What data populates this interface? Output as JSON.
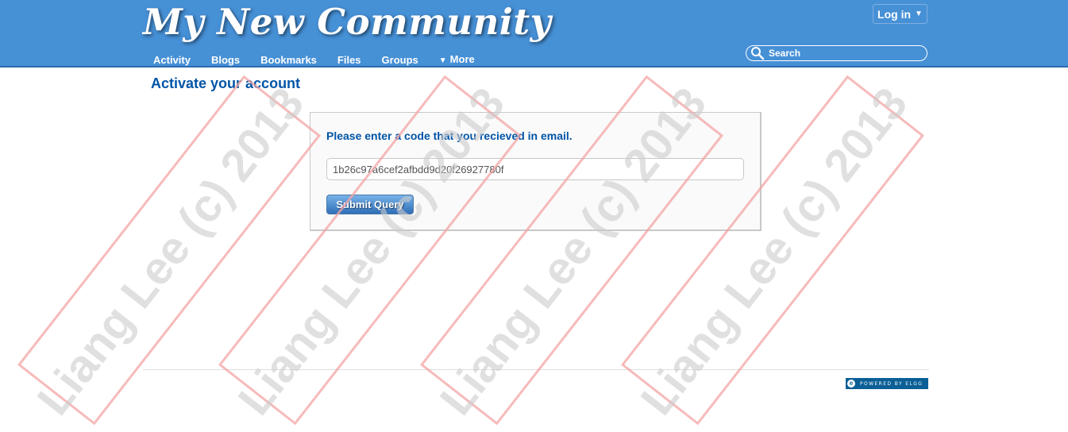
{
  "site": {
    "name": "My New Community"
  },
  "header": {
    "login_label": "Log in",
    "nav": [
      "Activity",
      "Blogs",
      "Bookmarks",
      "Files",
      "Groups",
      "More"
    ],
    "search_placeholder": "Search"
  },
  "main": {
    "title": "Activate your account",
    "prompt": "Please enter a code that you recieved in email.",
    "code_value": "1b26c97a6cef2afbdd9d20f26927780f",
    "submit_label": "Submit Query"
  },
  "footer": {
    "powered_by": "POWERED BY ELGG"
  },
  "watermark": {
    "text": "Liang Lee (c) 2013",
    "color": "#f4a3a3"
  },
  "colors": {
    "header": "#4690d6",
    "link": "#0054a7"
  }
}
